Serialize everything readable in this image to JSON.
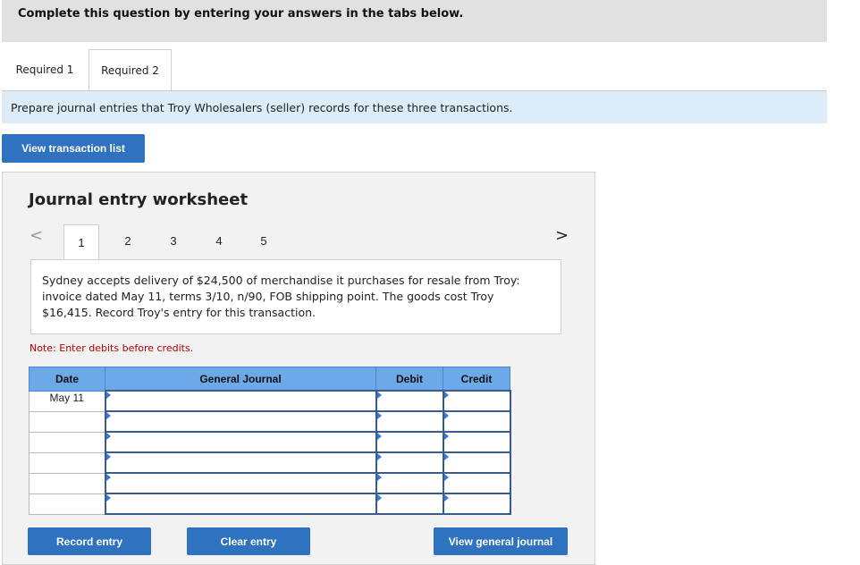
{
  "header": {
    "title": "Complete this question by entering your answers in the tabs below."
  },
  "tabs": [
    {
      "label": "Required 1"
    },
    {
      "label": "Required 2"
    }
  ],
  "instruction": "Prepare journal entries that Troy Wholesalers (seller) records for these three transactions.",
  "view_transaction_button": "View transaction list",
  "worksheet": {
    "title": "Journal entry worksheet",
    "nav_prev": "<",
    "nav_next": ">",
    "steps": [
      "1",
      "2",
      "3",
      "4",
      "5"
    ],
    "active_step": "1",
    "description": "Sydney accepts delivery of $24,500 of merchandise it purchases for resale from Troy: invoice dated May 11, terms 3/10, n/90, FOB shipping point. The goods cost Troy $16,415. Record Troy's entry for this transaction.",
    "note": "Note: Enter debits before credits.",
    "table": {
      "headers": {
        "date": "Date",
        "general_journal": "General Journal",
        "debit": "Debit",
        "credit": "Credit"
      },
      "rows": [
        {
          "date": "May 11",
          "account": "",
          "debit": "",
          "credit": ""
        },
        {
          "date": "",
          "account": "",
          "debit": "",
          "credit": ""
        },
        {
          "date": "",
          "account": "",
          "debit": "",
          "credit": ""
        },
        {
          "date": "",
          "account": "",
          "debit": "",
          "credit": ""
        },
        {
          "date": "",
          "account": "",
          "debit": "",
          "credit": ""
        },
        {
          "date": "",
          "account": "",
          "debit": "",
          "credit": ""
        }
      ]
    },
    "buttons": {
      "record": "Record entry",
      "clear": "Clear entry",
      "view_general": "View general journal"
    }
  },
  "colors": {
    "primary_button": "#2e72c0",
    "table_header": "#6da8e8",
    "instruction_bg": "#dcecf9",
    "note_text": "#b30000"
  }
}
